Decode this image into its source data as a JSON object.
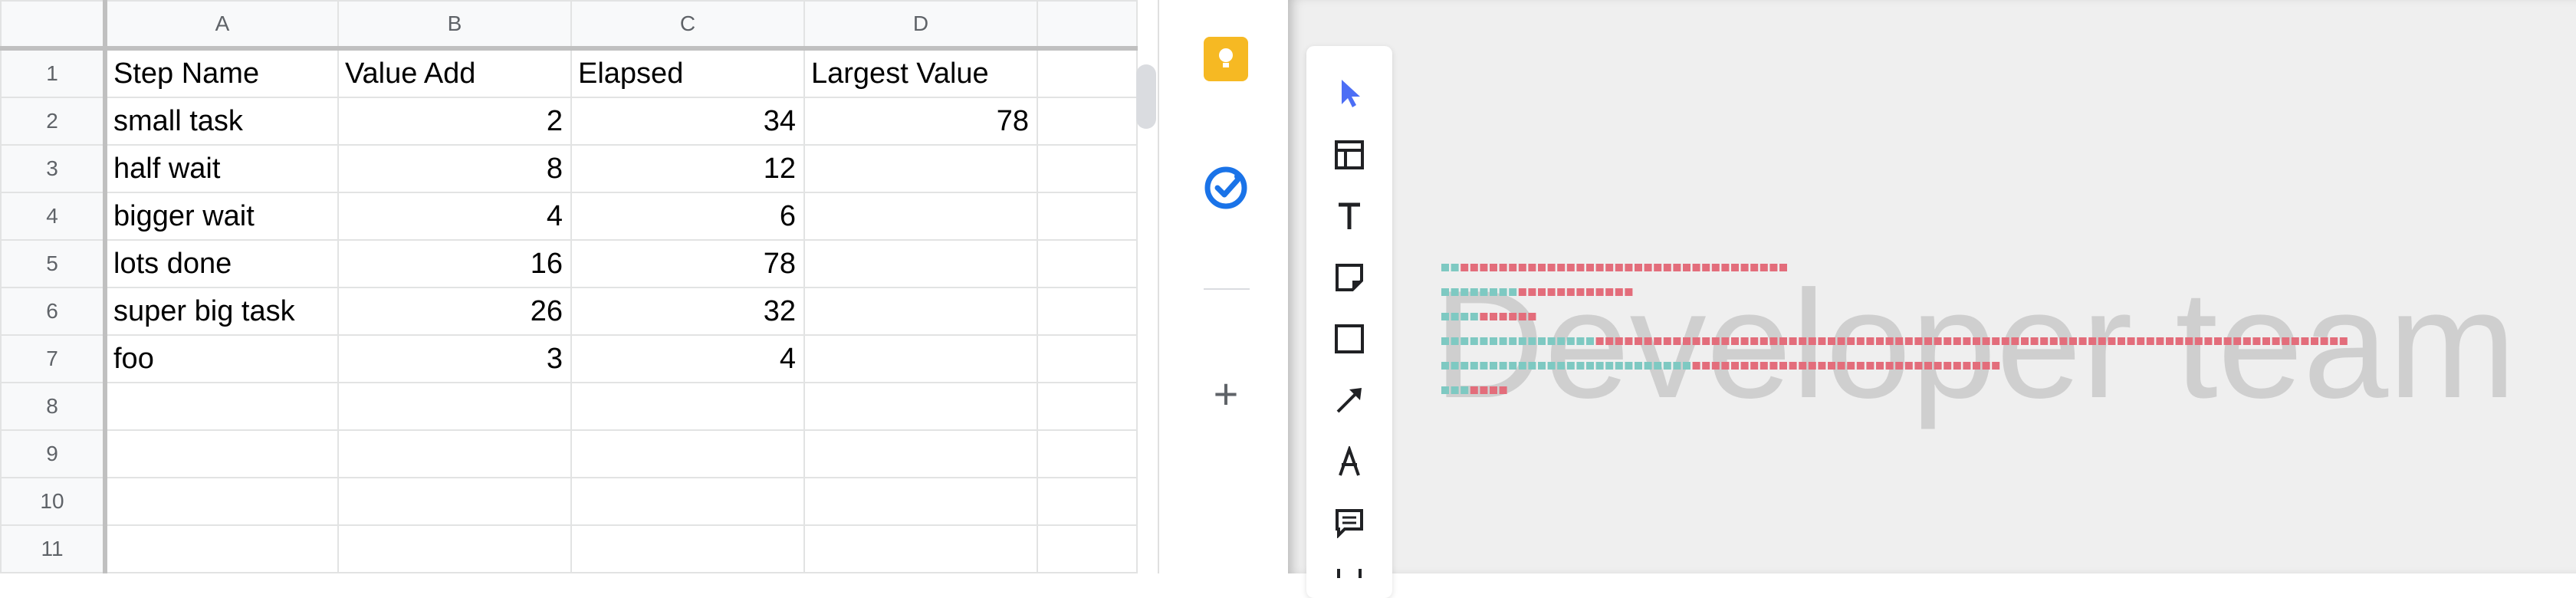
{
  "spreadsheet": {
    "column_headers": [
      "A",
      "B",
      "C",
      "D"
    ],
    "row_numbers": [
      "1",
      "2",
      "3",
      "4",
      "5",
      "6",
      "7",
      "8",
      "9",
      "10",
      "11"
    ],
    "rows": [
      [
        "Step Name",
        "Value Add",
        "Elapsed",
        "Largest Value"
      ],
      [
        "small task",
        "2",
        "34",
        "78"
      ],
      [
        "half wait",
        "8",
        "12",
        ""
      ],
      [
        "bigger wait",
        "4",
        "6",
        ""
      ],
      [
        "lots done",
        "16",
        "78",
        ""
      ],
      [
        "super big task",
        "26",
        "32",
        ""
      ],
      [
        "foo",
        "3",
        "4",
        ""
      ],
      [
        "",
        "",
        "",
        ""
      ],
      [
        "",
        "",
        "",
        ""
      ],
      [
        "",
        "",
        "",
        ""
      ],
      [
        "",
        "",
        "",
        ""
      ]
    ]
  },
  "side_panel": {
    "icons": [
      "keep-icon",
      "tasks-icon",
      "add-icon"
    ]
  },
  "whiteboard": {
    "watermark": "Developer team",
    "tools": [
      "select-tool-icon",
      "frame-tool-icon",
      "text-tool-icon",
      "sticky-note-tool-icon",
      "shape-tool-icon",
      "arrow-tool-icon",
      "pen-tool-icon",
      "comment-tool-icon",
      "more-tool-icon"
    ],
    "colors": {
      "value_add": "#7ec9c2",
      "wait": "#e36d7b",
      "select_tool": "#4c6ef5"
    },
    "bar_rows": [
      {
        "value_add": 2,
        "elapsed": 34
      },
      {
        "value_add": 8,
        "elapsed": 12
      },
      {
        "value_add": 4,
        "elapsed": 6
      },
      {
        "value_add": 16,
        "elapsed": 78
      },
      {
        "value_add": 26,
        "elapsed": 32
      },
      {
        "value_add": 3,
        "elapsed": 4
      }
    ]
  }
}
